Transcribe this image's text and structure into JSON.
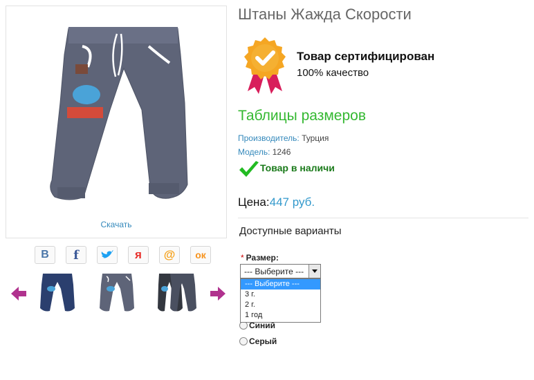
{
  "product": {
    "title": "Штаны Жажда Скорости",
    "download_label": "Скачать"
  },
  "certificate": {
    "title": "Товар сертифицирован",
    "subtitle": "100% качество"
  },
  "sizes_link": "Таблицы размеров",
  "specs": {
    "manufacturer_key": "Производитель:",
    "manufacturer_value": "Турция",
    "model_key": "Модель:",
    "model_value": "1246"
  },
  "stock": "Товар в наличи",
  "price": {
    "label": "Цена:",
    "value": "447 руб."
  },
  "variants_title": "Доступные варианты",
  "size_field": {
    "required_mark": "*",
    "label": "Размер:",
    "selected": "--- Выберите ---",
    "options": [
      "--- Выберите ---",
      "3 г.",
      "2 г.",
      "1 год"
    ]
  },
  "color_options": [
    "Синий",
    "Серый"
  ],
  "share_icons": [
    {
      "name": "vk-icon",
      "glyph": "В",
      "color": "#4a76a8"
    },
    {
      "name": "facebook-icon",
      "glyph": "f",
      "color": "#3b5998"
    },
    {
      "name": "twitter-icon",
      "glyph": "🐦",
      "color": "#1da1f2"
    },
    {
      "name": "yaru-icon",
      "glyph": "я",
      "color": "#e8302c"
    },
    {
      "name": "mailru-icon",
      "glyph": "@",
      "color": "#f5a11a"
    },
    {
      "name": "odnoklassniki-icon",
      "glyph": "ок",
      "color": "#f7931e"
    }
  ],
  "colors": {
    "link_blue": "#3388bb",
    "green": "#34b831",
    "price_blue": "#3399cc",
    "arrow_purple": "#b0328e",
    "pants_gray": "#5e6478",
    "pants_navy": "#2b3f6e"
  }
}
